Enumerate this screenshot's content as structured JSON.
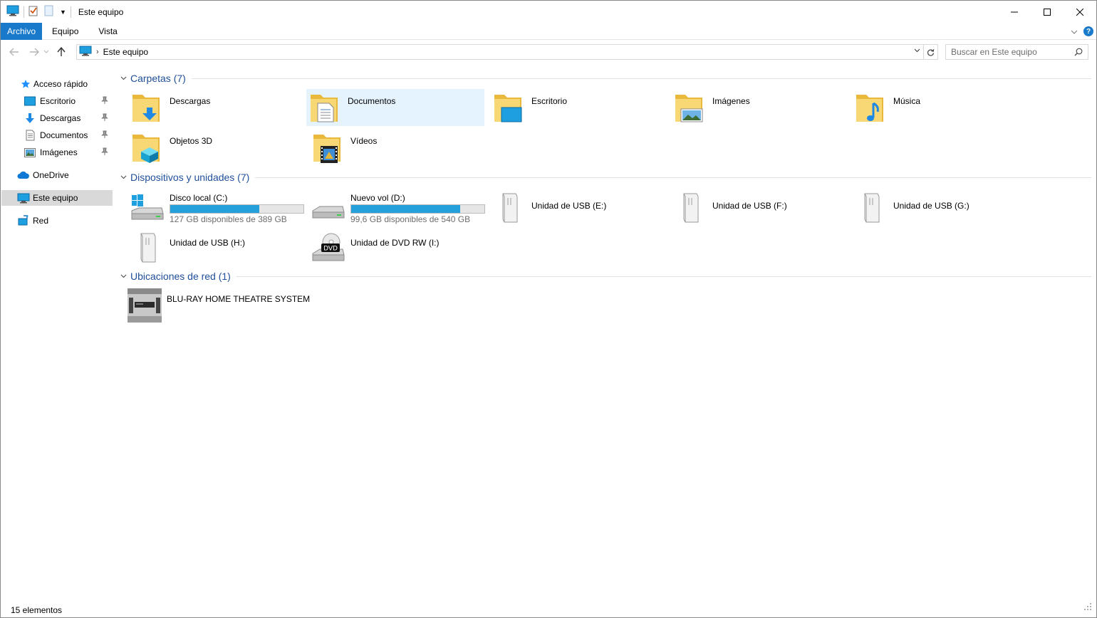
{
  "window": {
    "title": "Este equipo"
  },
  "ribbon": {
    "tabs": [
      "Archivo",
      "Equipo",
      "Vista"
    ]
  },
  "address": {
    "path": "Este equipo"
  },
  "search": {
    "placeholder": "Buscar en Este equipo"
  },
  "sidebar": {
    "items": [
      {
        "label": "Acceso rápido",
        "icon": "star-pin-icon"
      },
      {
        "label": "Escritorio",
        "icon": "desktop-icon",
        "pinned": true
      },
      {
        "label": "Descargas",
        "icon": "download-arrow-icon",
        "pinned": true
      },
      {
        "label": "Documentos",
        "icon": "document-icon",
        "pinned": true
      },
      {
        "label": "Imágenes",
        "icon": "image-icon",
        "pinned": true
      },
      {
        "label": "OneDrive",
        "icon": "cloud-icon"
      },
      {
        "label": "Este equipo",
        "icon": "computer-icon",
        "selected": true
      },
      {
        "label": "Red",
        "icon": "network-icon"
      }
    ]
  },
  "groups": {
    "folders": {
      "title": "Carpetas (7)",
      "items": [
        "Descargas",
        "Documentos",
        "Escritorio",
        "Imágenes",
        "Música",
        "Objetos 3D",
        "Vídeos"
      ]
    },
    "devices": {
      "title": "Dispositivos y unidades (7)",
      "items": [
        {
          "name": "Disco local (C:)",
          "free": "127 GB disponibles de 389 GB",
          "used_fraction": 0.67
        },
        {
          "name": "Nuevo vol (D:)",
          "free": "99,6 GB disponibles de 540 GB",
          "used_fraction": 0.82
        },
        {
          "name": "Unidad de USB (E:)"
        },
        {
          "name": "Unidad de USB (F:)"
        },
        {
          "name": "Unidad de USB (G:)"
        },
        {
          "name": "Unidad de USB (H:)"
        },
        {
          "name": "Unidad de DVD RW (I:)"
        }
      ]
    },
    "network": {
      "title": "Ubicaciones de red (1)",
      "items": [
        "BLU-RAY HOME THEATRE SYSTEM"
      ]
    }
  },
  "status": {
    "count": "15 elementos"
  },
  "colors": {
    "accent": "#1979ca",
    "bar_fill": "#26a0da",
    "folder": "#f8d775",
    "group_title": "#1f4e9a"
  }
}
